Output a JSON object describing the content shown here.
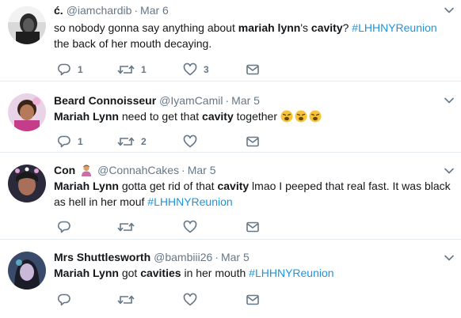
{
  "tweets": [
    {
      "name": "ć.",
      "handle": "@iamchardib",
      "sep": "·",
      "date": "Mar 6",
      "text": {
        "t1": "so nobody gonna say anything about ",
        "b1": "mariah lynn",
        "t2": "'s ",
        "b2": "cavity",
        "t3": "? ",
        "tag": "#LHHNYReunion",
        "t4": " the back of her mouth decaying."
      },
      "reply_count": "1",
      "retweet_count": "1",
      "like_count": "3"
    },
    {
      "name": "Beard Connoisseur",
      "handle": "@IyamCamil",
      "sep": "·",
      "date": "Mar 5",
      "text": {
        "b1": "Mariah Lynn",
        "t1": " need to get that ",
        "b2": "cavity",
        "t2": " together "
      },
      "emoji_count": 3,
      "emoji_name": "weary-face-emoji",
      "reply_count": "1",
      "retweet_count": "2",
      "like_count": ""
    },
    {
      "name": "Con",
      "handle": "@ConnahCakes",
      "sep": "·",
      "date": "Mar 5",
      "name_emoji": "person-emoji",
      "text": {
        "b1": "Mariah Lynn",
        "t1": " gotta get rid of that ",
        "b2": "cavity",
        "t2": " lmao I peeped that real fast. It was black as hell in her mouf ",
        "tag": "#LHHNYReunion"
      },
      "reply_count": "",
      "retweet_count": "",
      "like_count": ""
    },
    {
      "name": "Mrs Shuttlesworth",
      "handle": "@bambiii26",
      "sep": "·",
      "date": "Mar 5",
      "text": {
        "b1": "Mariah Lynn",
        "t1": " got ",
        "b2": "cavities",
        "t2": " in her mouth ",
        "tag": "#LHHNYReunion"
      },
      "reply_count": "",
      "retweet_count": "",
      "like_count": ""
    }
  ],
  "colors": {
    "text": "#14171a",
    "muted": "#657786",
    "hashtag": "#1b95e0",
    "divider": "#e6ecf0"
  },
  "icons": [
    "reply-icon",
    "retweet-icon",
    "like-icon",
    "direct-message-icon",
    "caret-down-icon"
  ]
}
